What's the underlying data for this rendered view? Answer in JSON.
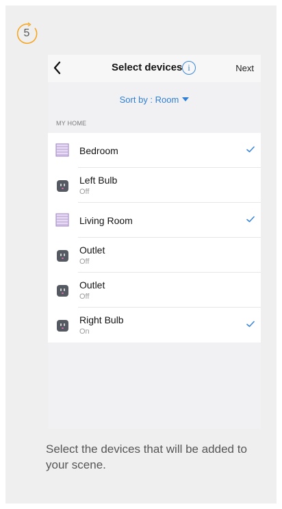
{
  "step": {
    "number": "5",
    "color": "#f5a623"
  },
  "navbar": {
    "back_icon": "chevron-left-icon",
    "title": "Select devices",
    "info_glyph": "i",
    "next_label": "Next"
  },
  "sort": {
    "label": "Sort by : Room",
    "icon": "caret-down-icon",
    "color": "#2f7fd6"
  },
  "section": {
    "label": "MY HOME"
  },
  "devices": [
    {
      "name": "Bedroom",
      "status": "",
      "icon": "room-icon",
      "checked": true
    },
    {
      "name": "Left Bulb",
      "status": "Off",
      "icon": "outlet-icon",
      "checked": false
    },
    {
      "name": "Living Room",
      "status": "",
      "icon": "room-icon",
      "checked": true
    },
    {
      "name": "Outlet",
      "status": "Off",
      "icon": "outlet-icon",
      "checked": false
    },
    {
      "name": "Outlet",
      "status": "Off",
      "icon": "outlet-icon",
      "checked": false
    },
    {
      "name": "Right Bulb",
      "status": "On",
      "icon": "outlet-icon",
      "checked": true
    }
  ],
  "caption": "Select the devices that will be added to your scene."
}
